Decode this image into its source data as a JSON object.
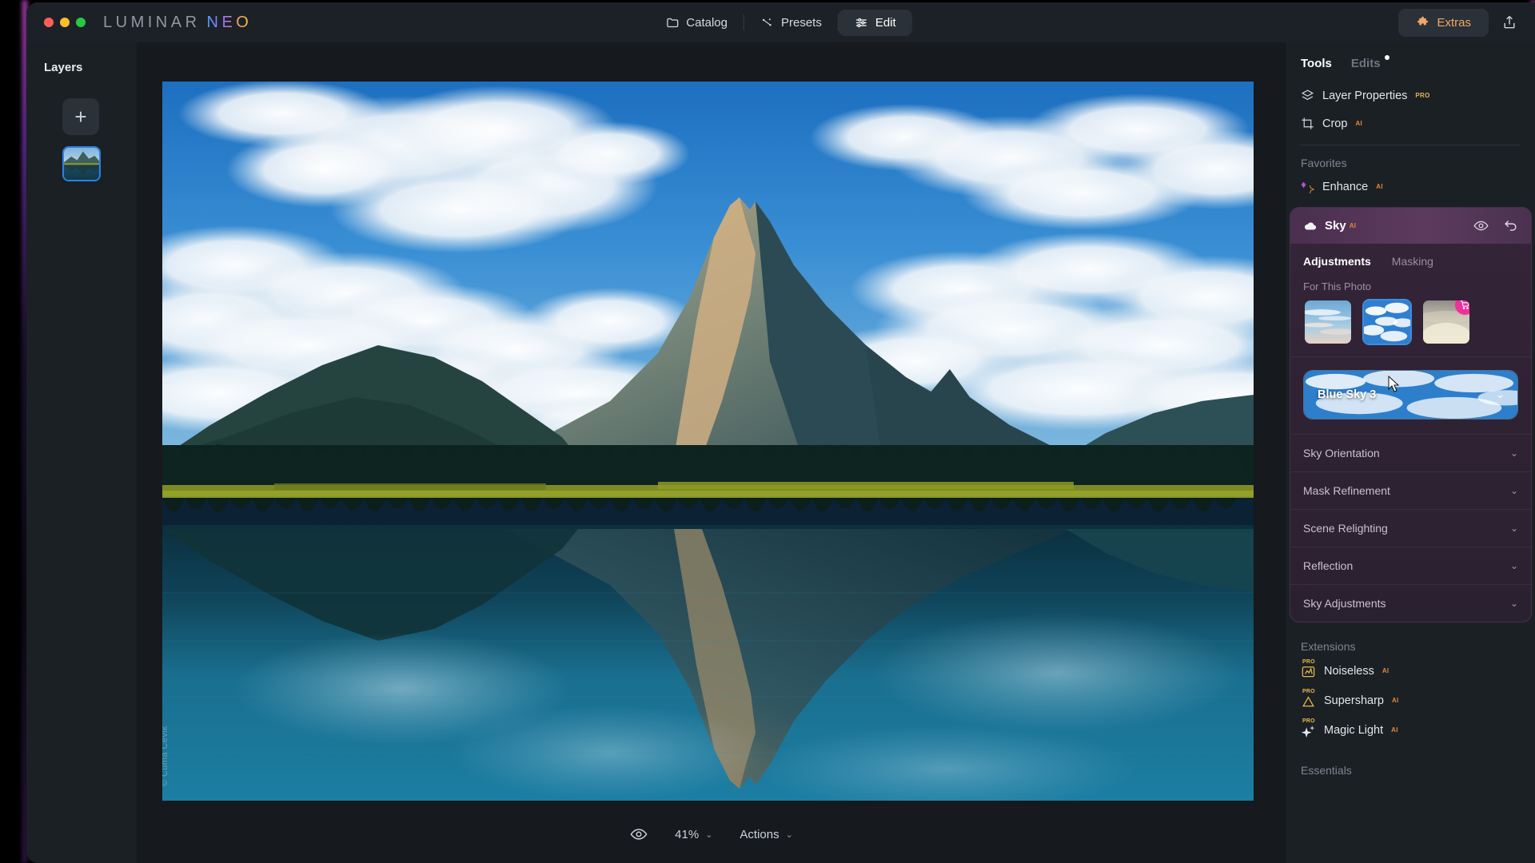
{
  "app": {
    "brand_first": "LUMINAR",
    "brand_second": "NEO"
  },
  "titlebar": {
    "tabs": [
      {
        "label": "Catalog",
        "icon": "folder-icon",
        "active": false
      },
      {
        "label": "Presets",
        "icon": "sparkle-icon",
        "active": false
      },
      {
        "label": "Edit",
        "icon": "sliders-icon",
        "active": true
      }
    ],
    "extras_label": "Extras",
    "extras_icon": "puzzle-icon",
    "share_icon": "share-icon"
  },
  "layers": {
    "title": "Layers",
    "add_label": "+",
    "items": [
      {
        "name": "mountain-lake-layer",
        "selected": true
      }
    ]
  },
  "canvas": {
    "watermark": "© Cuma Cevik",
    "bottom_bar": {
      "preview_icon": "eye-icon",
      "zoom_value": "41%",
      "zoom_chevron": "chevron-down-icon",
      "actions_label": "Actions",
      "actions_chevron": "chevron-down-icon"
    }
  },
  "tools": {
    "tabs": [
      {
        "label": "Tools",
        "active": true,
        "dot": false
      },
      {
        "label": "Edits",
        "active": false,
        "dot": true
      }
    ],
    "top_tools": [
      {
        "label": "Layer Properties",
        "badge": "PRO",
        "badge_type": "pro",
        "icon": "layers-icon"
      },
      {
        "label": "Crop",
        "badge": "AI",
        "badge_type": "ai",
        "icon": "crop-icon"
      }
    ],
    "favorites_label": "Favorites",
    "favorites": [
      {
        "label": "Enhance",
        "badge": "AI",
        "badge_type": "ai",
        "icon": "enhance-sparkle-icon"
      }
    ],
    "sky": {
      "title": "Sky",
      "badge": "AI",
      "icon": "cloud-icon",
      "visibility_icon": "eye-icon",
      "reset_icon": "undo-icon",
      "tabs": [
        {
          "label": "Adjustments",
          "active": true
        },
        {
          "label": "Masking",
          "active": false
        }
      ],
      "for_this_photo_label": "For This Photo",
      "thumbnails": [
        {
          "name": "wispy-sky-thumb",
          "selected": false,
          "locked": false
        },
        {
          "name": "blue-sky-thumb",
          "selected": true,
          "locked": false
        },
        {
          "name": "premium-sky-thumb",
          "selected": false,
          "locked": true,
          "badge_icon": "cart-icon"
        }
      ],
      "selected_sky": "Blue Sky 3",
      "selected_sky_chevron": "chevron-down-icon",
      "sections": [
        {
          "label": "Sky Orientation",
          "chevron": "chevron-down-icon"
        },
        {
          "label": "Mask Refinement",
          "chevron": "chevron-down-icon"
        },
        {
          "label": "Scene Relighting",
          "chevron": "chevron-down-icon"
        },
        {
          "label": "Reflection",
          "chevron": "chevron-down-icon"
        },
        {
          "label": "Sky Adjustments",
          "chevron": "chevron-down-icon"
        }
      ]
    },
    "extensions_label": "Extensions",
    "extensions": [
      {
        "label": "Noiseless",
        "badge": "AI",
        "pro": "PRO",
        "icon": "noiseless-icon"
      },
      {
        "label": "Supersharp",
        "badge": "AI",
        "pro": "PRO",
        "icon": "supersharp-icon"
      },
      {
        "label": "Magic Light",
        "badge": "AI",
        "pro": "PRO",
        "icon": "magic-light-icon"
      }
    ],
    "essentials_label": "Essentials"
  },
  "colors": {
    "accent_blue": "#3f8de0",
    "accent_pink": "#f0309b",
    "badge_pro": "#e3b84a",
    "badge_ai": "#e08a3c",
    "panel_bg": "#1b2025",
    "sky_panel": "#2e2233"
  }
}
